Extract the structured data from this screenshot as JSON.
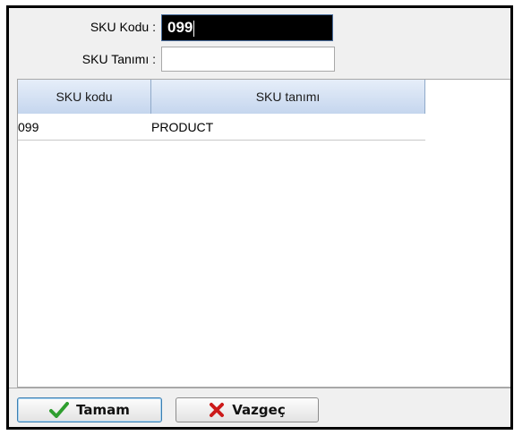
{
  "form": {
    "sku_code_label": "SKU Kodu :",
    "sku_code_value": "099",
    "sku_desc_label": "SKU Tanımı :",
    "sku_desc_value": ""
  },
  "grid": {
    "columns": [
      "SKU kodu",
      "SKU tanımı"
    ],
    "rows": [
      {
        "code": "099",
        "description": "PRODUCT"
      }
    ]
  },
  "buttons": {
    "ok_label": "Tamam",
    "ok_icon": "checkmark-icon",
    "cancel_label": "Vazgeç",
    "cancel_icon": "x-icon"
  },
  "colors": {
    "accent": "#3c7fb1",
    "ok_icon": "#2f9e2f",
    "cancel_icon": "#cc1a1a"
  }
}
